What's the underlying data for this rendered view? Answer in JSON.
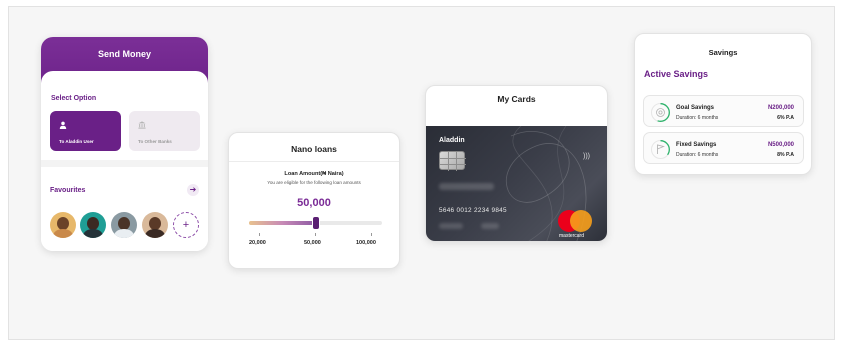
{
  "send_money": {
    "title": "Send Money",
    "select_option": "Select Option",
    "options": [
      {
        "label": "To Aladdin User",
        "icon": "user-icon",
        "active": true
      },
      {
        "label": "To Other Banks",
        "icon": "bank-icon",
        "active": false
      }
    ],
    "favourites": "Favourites",
    "favourite_avatars": 4,
    "colors": {
      "primary": "#6a2087"
    }
  },
  "nano_loans": {
    "title": "Nano loans",
    "loan_amount_label": "Loan Amount(₦ Naira)",
    "eligibility_text": "You are eligible for the following loan amounts",
    "selected_amount": "50,000",
    "slider": {
      "min": 20000,
      "max": 100000,
      "value": 50000
    },
    "ticks": [
      "20,000",
      "50,000",
      "100,000"
    ]
  },
  "my_cards": {
    "title": "My Cards",
    "brand": "Aladdin",
    "card_number": "5646 0012 2234 9845",
    "network": "mastercard"
  },
  "savings": {
    "title": "Savings",
    "section": "Active Savings",
    "items": [
      {
        "name": "Goal Savings",
        "duration": "Duration: 6 months",
        "amount": "N200,000",
        "rate": "6% P.A",
        "icon": "goal-icon",
        "progress": 0.55
      },
      {
        "name": "Fixed Savings",
        "duration": "Duration: 6 months",
        "amount": "N500,000",
        "rate": "8% P.A",
        "icon": "flag-icon",
        "progress": 0.35
      }
    ]
  }
}
